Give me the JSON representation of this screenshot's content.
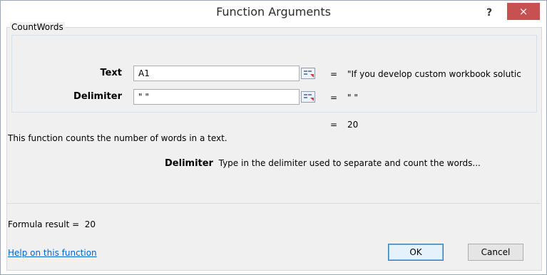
{
  "window": {
    "title": "Function Arguments",
    "help_label": "?",
    "close_label": "×"
  },
  "function": {
    "name": "CountWords",
    "arguments": [
      {
        "label": "Text",
        "value": "A1",
        "evaluated": "\"If you develop custom workbook solutic"
      },
      {
        "label": "Delimiter",
        "value": "\" \"",
        "evaluated": "\" \""
      }
    ],
    "result_equals": "=",
    "result_value": "20",
    "description": "This function counts the number of words in a text.",
    "arg_help": {
      "name": "Delimiter",
      "text": "Type in the delimiter used to separate and count the words..."
    }
  },
  "footer": {
    "formula_result_label": "Formula result =",
    "formula_result_value": "20",
    "help_link": "Help on this function",
    "ok_label": "OK",
    "cancel_label": "Cancel"
  },
  "icons": {
    "range_picker": "range-picker-icon",
    "help": "help-icon",
    "close": "close-icon"
  },
  "colors": {
    "close_button": "#c75050",
    "link": "#0066cc",
    "default_button_border": "#3c7fb1"
  }
}
